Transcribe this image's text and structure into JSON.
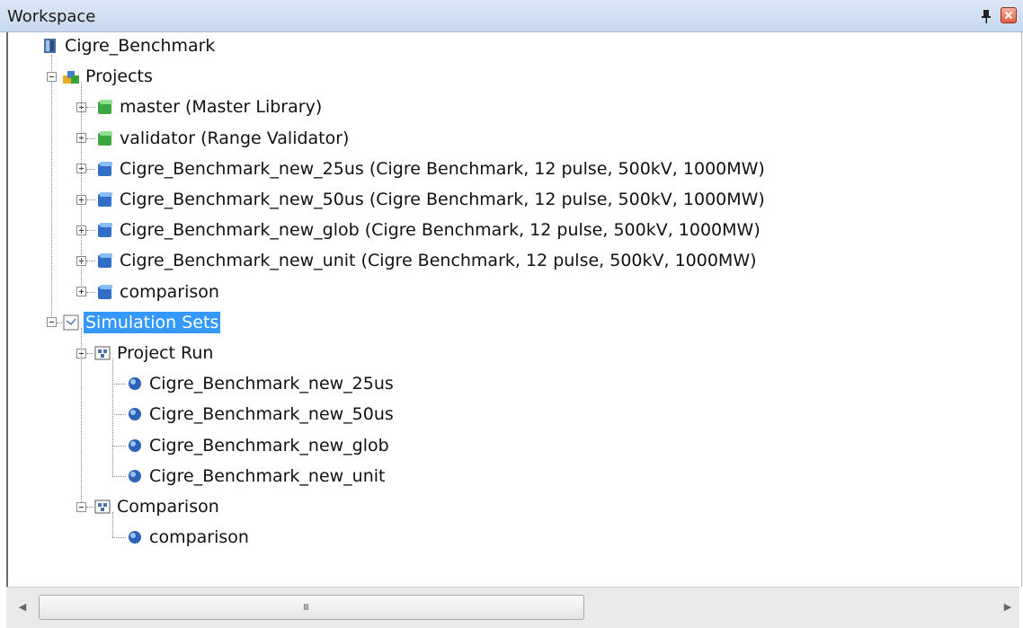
{
  "window": {
    "title": "Workspace",
    "pin_icon": "pin-icon",
    "close_icon": "close-icon"
  },
  "tree": {
    "root": {
      "label": "Cigre_Benchmark",
      "icon": "workspace-icon"
    },
    "projects": {
      "label": "Projects",
      "icon": "projects-folder-icon",
      "items": [
        {
          "label": "master (Master Library)",
          "icon": "library-green-icon"
        },
        {
          "label": "validator (Range Validator)",
          "icon": "library-green-icon"
        },
        {
          "label": "Cigre_Benchmark_new_25us (Cigre Benchmark, 12 pulse, 500kV, 1000MW)",
          "icon": "project-blue-icon"
        },
        {
          "label": "Cigre_Benchmark_new_50us (Cigre Benchmark, 12 pulse, 500kV, 1000MW)",
          "icon": "project-blue-icon"
        },
        {
          "label": "Cigre_Benchmark_new_glob (Cigre Benchmark, 12 pulse, 500kV, 1000MW)",
          "icon": "project-blue-icon"
        },
        {
          "label": "Cigre_Benchmark_new_unit (Cigre Benchmark, 12 pulse, 500kV, 1000MW)",
          "icon": "project-blue-icon"
        },
        {
          "label": "comparison",
          "icon": "project-blue-icon"
        }
      ]
    },
    "simulation_sets": {
      "label": "Simulation Sets",
      "icon": "simulation-sets-icon",
      "selected": true,
      "groups": [
        {
          "label": "Project Run",
          "icon": "simulation-task-icon",
          "items": [
            {
              "label": "Cigre_Benchmark_new_25us",
              "icon": "blue-ball-icon"
            },
            {
              "label": "Cigre_Benchmark_new_50us",
              "icon": "blue-ball-icon"
            },
            {
              "label": "Cigre_Benchmark_new_glob",
              "icon": "blue-ball-icon"
            },
            {
              "label": "Cigre_Benchmark_new_unit",
              "icon": "blue-ball-icon"
            }
          ]
        },
        {
          "label": "Comparison",
          "icon": "simulation-task-icon",
          "items": [
            {
              "label": "comparison",
              "icon": "blue-ball-icon"
            }
          ]
        }
      ]
    }
  },
  "scrollbar": {
    "thumb_grip": "III"
  }
}
